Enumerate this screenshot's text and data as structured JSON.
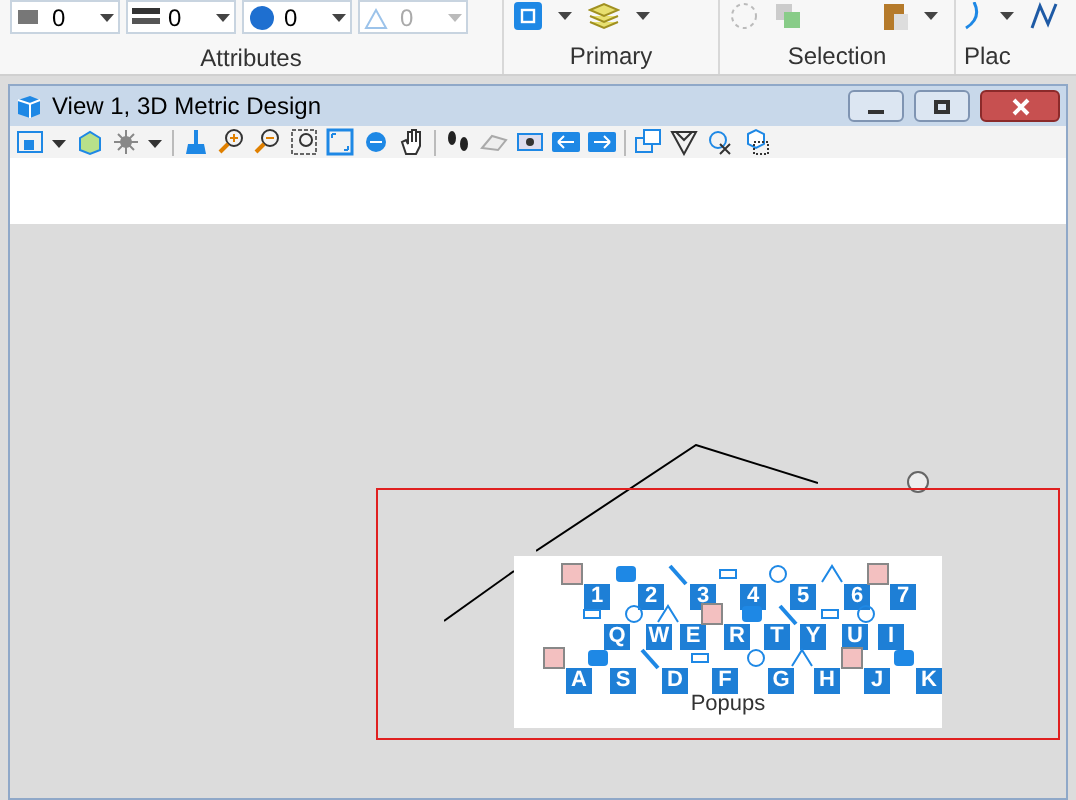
{
  "ribbon": {
    "dropdowns": [
      {
        "value": "0",
        "disabled": false
      },
      {
        "value": "0",
        "disabled": false
      },
      {
        "value": "0",
        "disabled": false
      },
      {
        "value": "0",
        "disabled": true
      }
    ],
    "groups": [
      {
        "label": "Attributes"
      },
      {
        "label": "Primary"
      },
      {
        "label": "Selection"
      },
      {
        "label": "Plac"
      }
    ]
  },
  "window": {
    "title": "View 1, 3D Metric Design"
  },
  "popup": {
    "title": "Popups",
    "rows": [
      [
        "1",
        "2",
        "3",
        "4",
        "5",
        "6",
        "7"
      ],
      [
        "Q",
        "W",
        "E",
        "R",
        "T",
        "Y",
        "U",
        "I"
      ],
      [
        "A",
        "S",
        "D",
        "F",
        "G",
        "H",
        "J",
        "K"
      ]
    ]
  }
}
